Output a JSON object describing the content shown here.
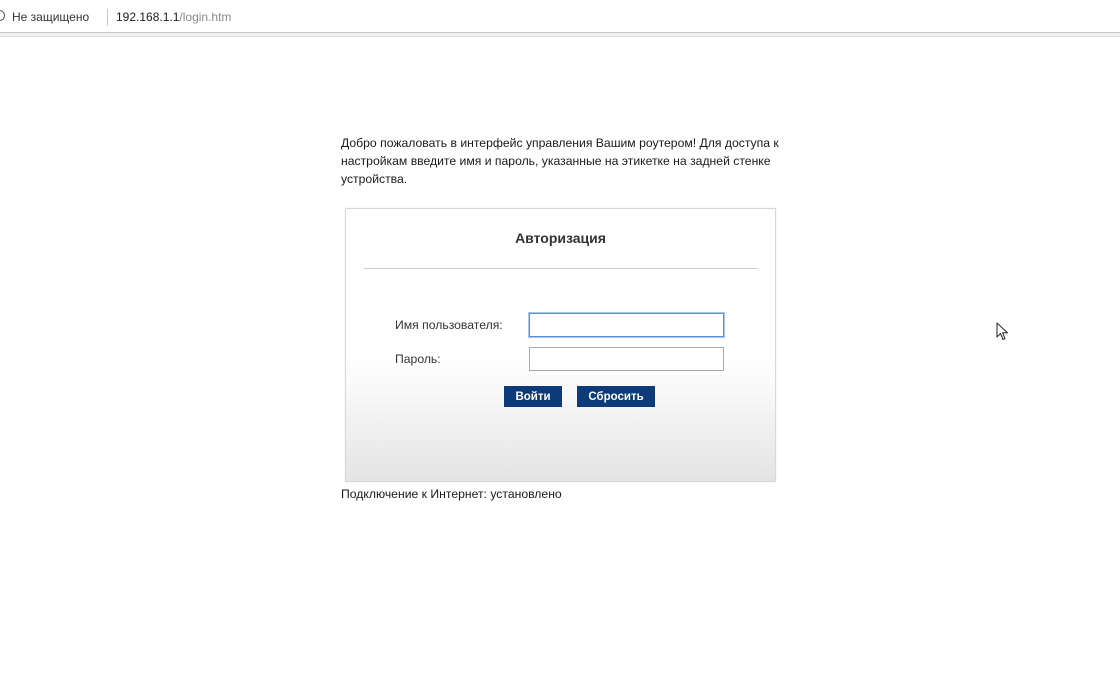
{
  "browser": {
    "security_label": "Не защищено",
    "url_host": "192.168.1.1",
    "url_path": "/login.htm",
    "icons": [
      "info-icon"
    ]
  },
  "page": {
    "welcome_text": "Добро пожаловать в интерфейс управления Вашим роутером! Для доступа к настройкам введите имя и пароль, указанные на этикетке на задней стенке устройства.",
    "login": {
      "title": "Авторизация",
      "username_label": "Имя пользователя:",
      "username_value": "",
      "password_label": "Пароль:",
      "password_value": "",
      "login_button": "Войти",
      "reset_button": "Сбросить"
    },
    "status_text": "Подключение к Интернет: установлено"
  },
  "colors": {
    "button_bg": "#0d3a78",
    "focus_border": "#5b8fd6"
  }
}
